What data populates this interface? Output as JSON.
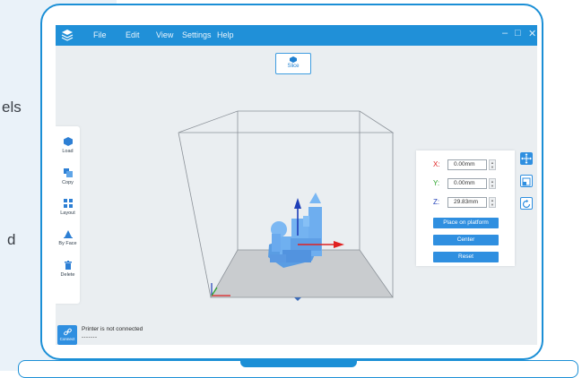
{
  "side_text": {
    "top_fragment": "els",
    "bottom_fragment": "d"
  },
  "menu": {
    "file": "File",
    "edit": "Edit",
    "view": "View",
    "settings": "Settings",
    "help": "Help"
  },
  "window_controls": {
    "minimize": "–",
    "maximize": "□",
    "close": "✕"
  },
  "slice": {
    "label": "Slice"
  },
  "toolbar": {
    "load": "Load",
    "copy": "Copy",
    "layout": "Layout",
    "by_face": "By Face",
    "delete": "Delete"
  },
  "position": {
    "x_label": "X:",
    "x_value": "0.00mm",
    "y_label": "Y:",
    "y_value": "0.00mm",
    "z_label": "Z:",
    "z_value": "29.83mm",
    "place_on_platform": "Place on platform",
    "center": "Center",
    "reset": "Reset"
  },
  "status": {
    "connect_label": "Connect",
    "message": "Printer is not connected",
    "sub": "-------"
  },
  "colors": {
    "accent": "#2090d8",
    "button": "#2f8fe0",
    "axis_x": "#e02020",
    "axis_y": "#2aa52a",
    "axis_z": "#1f3fb8",
    "model": "#6fb0f0",
    "plate": "#c9cccf"
  },
  "icons": {
    "app_logo": "layers-icon",
    "slice": "cube-icon",
    "load": "cube-load-icon",
    "copy": "copy-icon",
    "layout": "grid-icon",
    "by_face": "face-align-icon",
    "delete": "trash-icon",
    "move": "move-arrows-icon",
    "scale": "scale-icon",
    "rotate": "rotate-icon",
    "connect": "link-icon"
  }
}
